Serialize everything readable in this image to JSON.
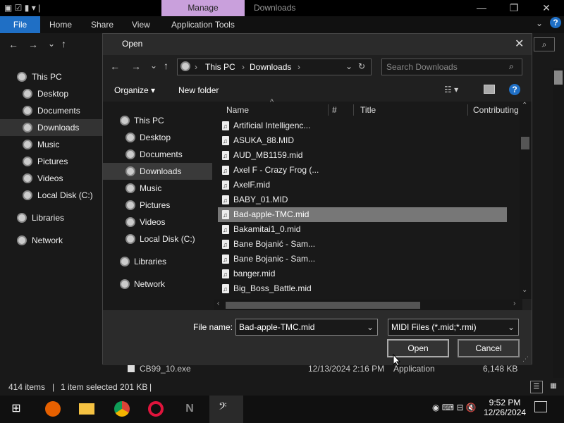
{
  "explorer": {
    "manage_tab": "Manage",
    "window_title": "Downloads",
    "ribbon": {
      "file": "File",
      "home": "Home",
      "share": "Share",
      "view": "View",
      "app_tools": "Application Tools"
    },
    "nav": [
      {
        "label": "This PC",
        "root": true
      },
      {
        "label": "Desktop"
      },
      {
        "label": "Documents"
      },
      {
        "label": "Downloads",
        "selected": true
      },
      {
        "label": "Music"
      },
      {
        "label": "Pictures"
      },
      {
        "label": "Videos"
      },
      {
        "label": "Local Disk (C:)"
      },
      {
        "label": "Libraries",
        "root": true
      },
      {
        "label": "Network",
        "root": true
      }
    ],
    "bg_row": {
      "name": "CB99_10.exe",
      "date": "12/13/2024 2:16 PM",
      "type": "Application",
      "size": "6,148 KB"
    },
    "status": {
      "items": "414 items",
      "selected": "1 item selected  201 KB"
    }
  },
  "dialog": {
    "title": "Open",
    "breadcrumb": [
      "This PC",
      "Downloads"
    ],
    "search_placeholder": "Search Downloads",
    "organize": "Organize",
    "new_folder": "New folder",
    "nav": [
      {
        "label": "This PC",
        "root": true
      },
      {
        "label": "Desktop"
      },
      {
        "label": "Documents"
      },
      {
        "label": "Downloads",
        "selected": true
      },
      {
        "label": "Music"
      },
      {
        "label": "Pictures"
      },
      {
        "label": "Videos"
      },
      {
        "label": "Local Disk (C:)"
      },
      {
        "label": "Libraries",
        "root": true
      },
      {
        "label": "Network",
        "root": true
      }
    ],
    "columns": {
      "name": "Name",
      "num": "#",
      "title": "Title",
      "contributing": "Contributing"
    },
    "files": [
      {
        "name": "Artificial Intelligenc..."
      },
      {
        "name": "ASUKA_88.MID"
      },
      {
        "name": "AUD_MB1159.mid"
      },
      {
        "name": "Axel F - Crazy Frog (..."
      },
      {
        "name": "AxelF.mid"
      },
      {
        "name": "BABY_01.MID"
      },
      {
        "name": "Bad-apple-TMC.mid",
        "selected": true
      },
      {
        "name": "Bakamitai1_0.mid"
      },
      {
        "name": "Bane Bojanić - Sam..."
      },
      {
        "name": "Bane Bojanic - Sam..."
      },
      {
        "name": "banger.mid"
      },
      {
        "name": "Big_Boss_Battle.mid"
      }
    ],
    "filename_label": "File name:",
    "filename_value": "Bad-apple-TMC.mid",
    "filter_value": "MIDI Files (*.mid;*.rmi)",
    "open": "Open",
    "cancel": "Cancel"
  },
  "taskbar": {
    "time": "9:52 PM",
    "date": "12/26/2024"
  },
  "colors": {
    "accent": "#1f6fc5",
    "manage": "#c9a0dc",
    "selected_row": "#777777"
  }
}
